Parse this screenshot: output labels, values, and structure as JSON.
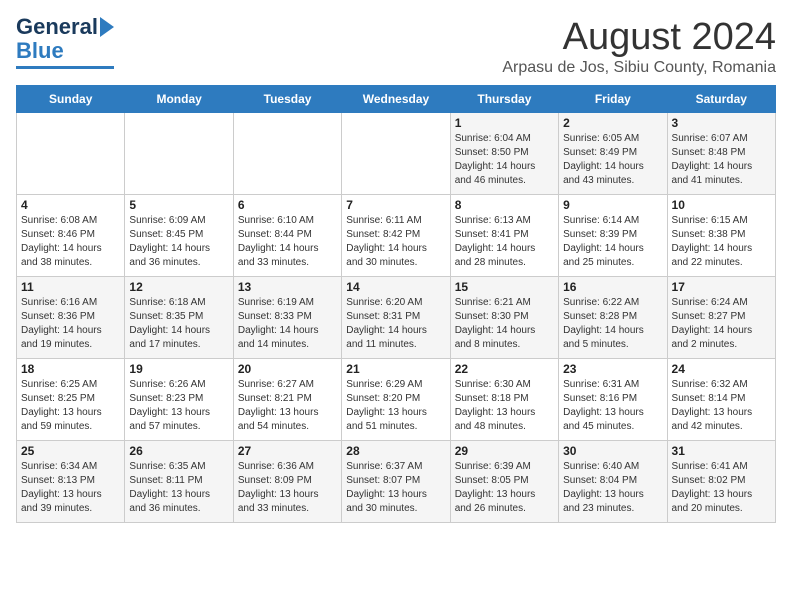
{
  "header": {
    "logo_general": "General",
    "logo_blue": "Blue",
    "month_title": "August 2024",
    "location": "Arpasu de Jos, Sibiu County, Romania"
  },
  "days_of_week": [
    "Sunday",
    "Monday",
    "Tuesday",
    "Wednesday",
    "Thursday",
    "Friday",
    "Saturday"
  ],
  "weeks": [
    [
      {
        "day": "",
        "info": ""
      },
      {
        "day": "",
        "info": ""
      },
      {
        "day": "",
        "info": ""
      },
      {
        "day": "",
        "info": ""
      },
      {
        "day": "1",
        "info": "Sunrise: 6:04 AM\nSunset: 8:50 PM\nDaylight: 14 hours\nand 46 minutes."
      },
      {
        "day": "2",
        "info": "Sunrise: 6:05 AM\nSunset: 8:49 PM\nDaylight: 14 hours\nand 43 minutes."
      },
      {
        "day": "3",
        "info": "Sunrise: 6:07 AM\nSunset: 8:48 PM\nDaylight: 14 hours\nand 41 minutes."
      }
    ],
    [
      {
        "day": "4",
        "info": "Sunrise: 6:08 AM\nSunset: 8:46 PM\nDaylight: 14 hours\nand 38 minutes."
      },
      {
        "day": "5",
        "info": "Sunrise: 6:09 AM\nSunset: 8:45 PM\nDaylight: 14 hours\nand 36 minutes."
      },
      {
        "day": "6",
        "info": "Sunrise: 6:10 AM\nSunset: 8:44 PM\nDaylight: 14 hours\nand 33 minutes."
      },
      {
        "day": "7",
        "info": "Sunrise: 6:11 AM\nSunset: 8:42 PM\nDaylight: 14 hours\nand 30 minutes."
      },
      {
        "day": "8",
        "info": "Sunrise: 6:13 AM\nSunset: 8:41 PM\nDaylight: 14 hours\nand 28 minutes."
      },
      {
        "day": "9",
        "info": "Sunrise: 6:14 AM\nSunset: 8:39 PM\nDaylight: 14 hours\nand 25 minutes."
      },
      {
        "day": "10",
        "info": "Sunrise: 6:15 AM\nSunset: 8:38 PM\nDaylight: 14 hours\nand 22 minutes."
      }
    ],
    [
      {
        "day": "11",
        "info": "Sunrise: 6:16 AM\nSunset: 8:36 PM\nDaylight: 14 hours\nand 19 minutes."
      },
      {
        "day": "12",
        "info": "Sunrise: 6:18 AM\nSunset: 8:35 PM\nDaylight: 14 hours\nand 17 minutes."
      },
      {
        "day": "13",
        "info": "Sunrise: 6:19 AM\nSunset: 8:33 PM\nDaylight: 14 hours\nand 14 minutes."
      },
      {
        "day": "14",
        "info": "Sunrise: 6:20 AM\nSunset: 8:31 PM\nDaylight: 14 hours\nand 11 minutes."
      },
      {
        "day": "15",
        "info": "Sunrise: 6:21 AM\nSunset: 8:30 PM\nDaylight: 14 hours\nand 8 minutes."
      },
      {
        "day": "16",
        "info": "Sunrise: 6:22 AM\nSunset: 8:28 PM\nDaylight: 14 hours\nand 5 minutes."
      },
      {
        "day": "17",
        "info": "Sunrise: 6:24 AM\nSunset: 8:27 PM\nDaylight: 14 hours\nand 2 minutes."
      }
    ],
    [
      {
        "day": "18",
        "info": "Sunrise: 6:25 AM\nSunset: 8:25 PM\nDaylight: 13 hours\nand 59 minutes."
      },
      {
        "day": "19",
        "info": "Sunrise: 6:26 AM\nSunset: 8:23 PM\nDaylight: 13 hours\nand 57 minutes."
      },
      {
        "day": "20",
        "info": "Sunrise: 6:27 AM\nSunset: 8:21 PM\nDaylight: 13 hours\nand 54 minutes."
      },
      {
        "day": "21",
        "info": "Sunrise: 6:29 AM\nSunset: 8:20 PM\nDaylight: 13 hours\nand 51 minutes."
      },
      {
        "day": "22",
        "info": "Sunrise: 6:30 AM\nSunset: 8:18 PM\nDaylight: 13 hours\nand 48 minutes."
      },
      {
        "day": "23",
        "info": "Sunrise: 6:31 AM\nSunset: 8:16 PM\nDaylight: 13 hours\nand 45 minutes."
      },
      {
        "day": "24",
        "info": "Sunrise: 6:32 AM\nSunset: 8:14 PM\nDaylight: 13 hours\nand 42 minutes."
      }
    ],
    [
      {
        "day": "25",
        "info": "Sunrise: 6:34 AM\nSunset: 8:13 PM\nDaylight: 13 hours\nand 39 minutes."
      },
      {
        "day": "26",
        "info": "Sunrise: 6:35 AM\nSunset: 8:11 PM\nDaylight: 13 hours\nand 36 minutes."
      },
      {
        "day": "27",
        "info": "Sunrise: 6:36 AM\nSunset: 8:09 PM\nDaylight: 13 hours\nand 33 minutes."
      },
      {
        "day": "28",
        "info": "Sunrise: 6:37 AM\nSunset: 8:07 PM\nDaylight: 13 hours\nand 30 minutes."
      },
      {
        "day": "29",
        "info": "Sunrise: 6:39 AM\nSunset: 8:05 PM\nDaylight: 13 hours\nand 26 minutes."
      },
      {
        "day": "30",
        "info": "Sunrise: 6:40 AM\nSunset: 8:04 PM\nDaylight: 13 hours\nand 23 minutes."
      },
      {
        "day": "31",
        "info": "Sunrise: 6:41 AM\nSunset: 8:02 PM\nDaylight: 13 hours\nand 20 minutes."
      }
    ]
  ]
}
